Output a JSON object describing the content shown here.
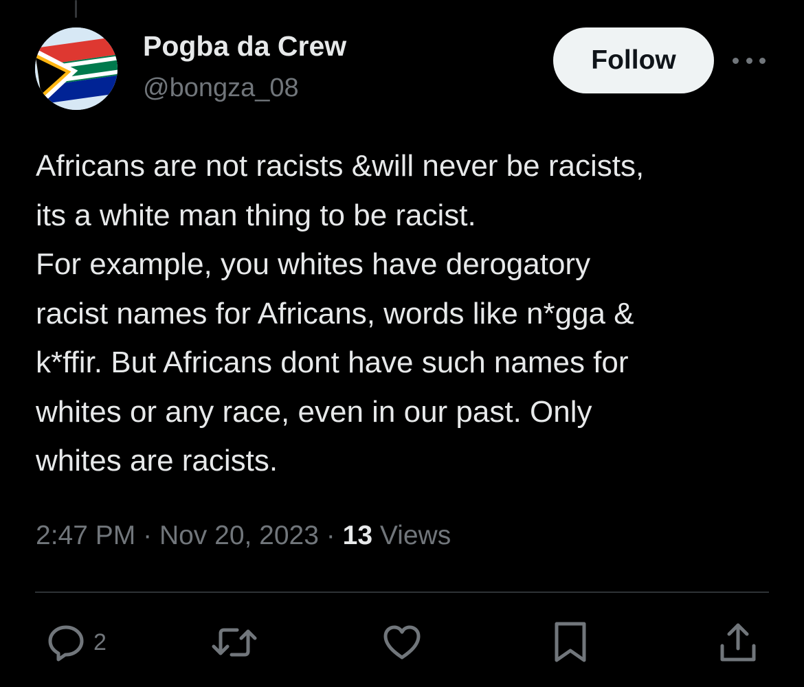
{
  "tweet": {
    "author": {
      "display_name": "Pogba da Crew",
      "handle": "@bongza_08",
      "avatar": "south-africa-flag"
    },
    "follow_label": "Follow",
    "text_lines": [
      "Africans are not racists &will never be racists,",
      "its a white man thing to be racist.",
      "For example, you whites have derogatory",
      "racist names for Africans, words like n*gga &",
      "k*ffir. But Africans dont have such names for",
      "whites or any race, even in our past. Only",
      "whites are racists."
    ],
    "time": "2:47 PM",
    "separator": "·",
    "date": "Nov 20, 2023",
    "views_count": "13",
    "views_label": "Views"
  },
  "actions": {
    "reply": {
      "icon": "reply-icon",
      "count": "2"
    },
    "retweet": {
      "icon": "retweet-icon"
    },
    "like": {
      "icon": "heart-icon"
    },
    "bookmark": {
      "icon": "bookmark-icon"
    },
    "share": {
      "icon": "share-icon"
    }
  },
  "colors": {
    "background": "#000000",
    "text_primary": "#e7e9ea",
    "text_secondary": "#71767b",
    "follow_bg": "#eff3f4",
    "follow_text": "#0f1419",
    "divider": "#2f3336"
  }
}
